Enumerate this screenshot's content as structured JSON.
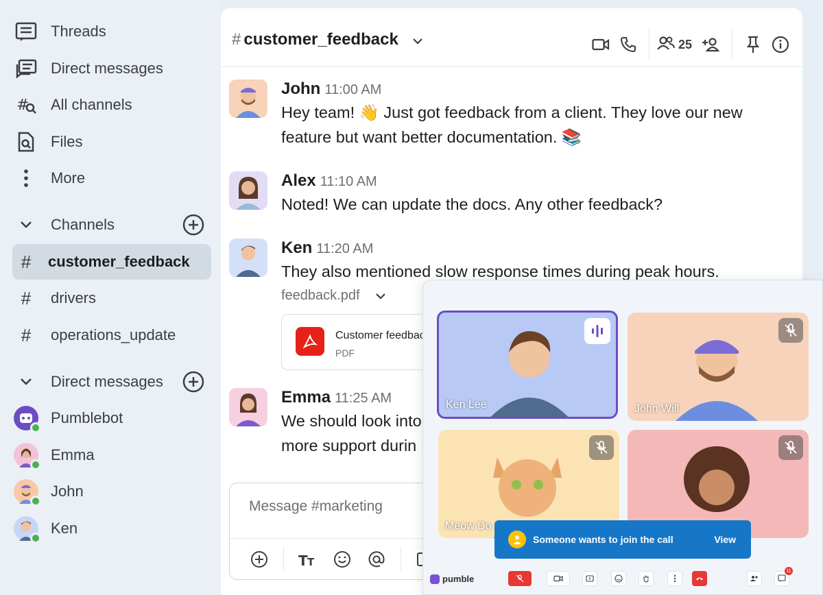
{
  "sidebar": {
    "nav": [
      {
        "label": "Threads",
        "icon": "threads-icon"
      },
      {
        "label": "Direct messages",
        "icon": "direct-messages-icon"
      },
      {
        "label": "All channels",
        "icon": "all-channels-icon"
      },
      {
        "label": "Files",
        "icon": "files-icon"
      },
      {
        "label": "More",
        "icon": "more-icon"
      }
    ],
    "channels_header": "Channels",
    "channels": [
      {
        "label": "customer_feedback",
        "active": true
      },
      {
        "label": "drivers",
        "active": false
      },
      {
        "label": "operations_update",
        "active": false
      }
    ],
    "dm_header": "Direct messages",
    "dms": [
      {
        "label": "Pumblebot",
        "color": "#6c4cc2"
      },
      {
        "label": "Emma",
        "color": "#f3c3d8"
      },
      {
        "label": "John",
        "color": "#f7c9a8"
      },
      {
        "label": "Ken",
        "color": "#c7d6f5"
      }
    ]
  },
  "header": {
    "hash": "#",
    "channel": "customer_feedback",
    "member_count": "25"
  },
  "messages": [
    {
      "name": "John",
      "time": "11:00 AM",
      "text": "Hey team! 👋 Just got feedback from a client. They love our new feature but want better documentation. 📚",
      "bg": "#f8d3b9"
    },
    {
      "name": "Alex",
      "time": "11:10 AM",
      "text": "Noted! We can update the docs. Any other feedback?",
      "bg": "#e3dcf5"
    },
    {
      "name": "Ken",
      "time": "11:20 AM",
      "text": "They also mentioned slow response times during peak hours.",
      "bg": "#d4e0f7"
    },
    {
      "name": "Emma",
      "time": "11:25 AM",
      "text": "We should look into more support durin",
      "bg": "#f6cfe0"
    }
  ],
  "attachment": {
    "filename": "feedback.pdf",
    "title": "Customer feedbac",
    "type": "PDF"
  },
  "composer": {
    "placeholder": "Message #marketing"
  },
  "call": {
    "tiles": [
      {
        "name": "Ken Lee",
        "bg": "#b7c9f4",
        "speaking": true
      },
      {
        "name": "John Will",
        "bg": "#f7d3bc",
        "speaking": false
      },
      {
        "name": "Meow Do",
        "bg": "#fbe3b4",
        "speaking": false
      },
      {
        "name": "",
        "bg": "#f5b8b8",
        "speaking": false
      }
    ],
    "toast_text": "Someone wants to join the call",
    "toast_action": "View",
    "brand": "pumble",
    "chat_badge": "11"
  },
  "colors": {
    "accent": "#6c4cc2",
    "online": "#4caf50",
    "toast": "#1677c9",
    "end_call": "#e53935"
  }
}
